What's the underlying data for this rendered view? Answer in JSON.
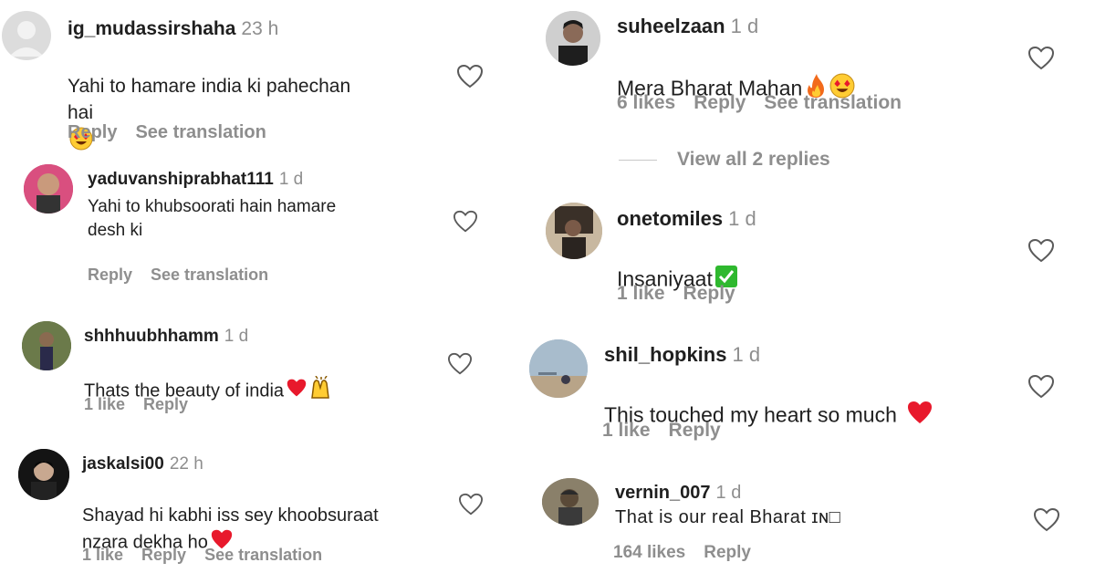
{
  "comments_left": [
    {
      "username": "ig_mudassirshaha",
      "time": "23 h",
      "text": "Yahi to hamare india ki pahechan\nhai",
      "emojis": [
        "heart-eyes",
        "heart-eyes"
      ],
      "actions": [
        "Reply",
        "See translation"
      ]
    },
    {
      "username": "yaduvanshiprabhat111",
      "time": "1 d",
      "text": "Yahi to khubsoorati hain hamare\ndesh ki",
      "emojis": [],
      "actions": [
        "Reply",
        "See translation"
      ]
    },
    {
      "username": "shhhuubhhamm",
      "time": "1 d",
      "text": "Thats the beauty of india",
      "emojis": [
        "red-heart",
        "raising-hands"
      ],
      "actions": [
        "1 like",
        "Reply"
      ]
    },
    {
      "username": "jaskalsi00",
      "time": "22 h",
      "text": "Shayad hi kabhi iss sey khoobsuraat\nnzara dekha ho",
      "emojis": [
        "red-heart"
      ],
      "actions": [
        "1 like",
        "Reply",
        "See translation"
      ]
    }
  ],
  "comments_right": [
    {
      "username": "suheelzaan",
      "time": "1 d",
      "text": "Mera Bharat Mahan",
      "emojis": [
        "fire",
        "heart-eyes"
      ],
      "actions": [
        "6 likes",
        "Reply",
        "See translation"
      ]
    },
    {
      "username": "onetomiles",
      "time": "1 d",
      "text": "Insaniyaat",
      "emojis": [
        "check-mark"
      ],
      "actions": [
        "1 like",
        "Reply"
      ]
    },
    {
      "username": "shil_hopkins",
      "time": "1 d",
      "text": "This touched my heart so much",
      "emojis": [
        "red-heart"
      ],
      "actions": [
        "1 like",
        "Reply"
      ]
    },
    {
      "username": "vernin_007",
      "time": "1 d",
      "text": "That is our real Bharat ɪɴ□",
      "emojis": [],
      "actions": [
        "164 likes",
        "Reply"
      ]
    }
  ],
  "view_replies_label": "View all 2 replies",
  "icons": {
    "like": "heart-outline-icon",
    "avatar_default": "default-avatar-icon"
  },
  "colors": {
    "muted": "#8e8e8e",
    "heart_red": "#e8192c",
    "emoji_yellow": "#ffcc33",
    "check_green": "#2eb82e"
  }
}
